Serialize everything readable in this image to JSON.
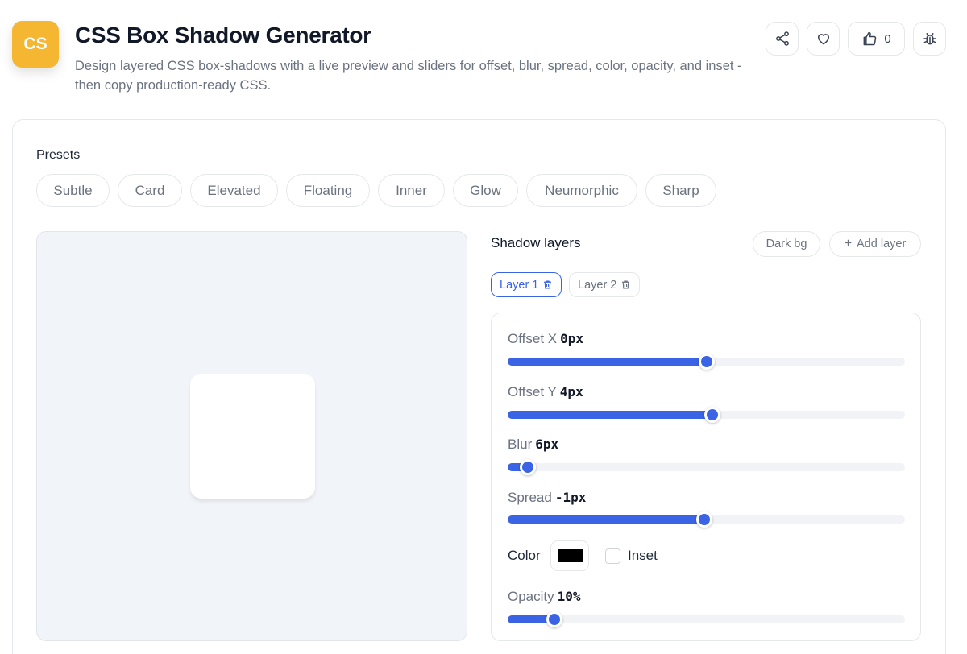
{
  "header": {
    "logo_text": "CS",
    "title": "CSS Box Shadow Generator",
    "description": "Design layered CSS box-shadows with a live preview and sliders for offset, blur, spread, color, opacity, and inset - then copy production-ready CSS.",
    "like_count": "0",
    "icons": [
      "share-icon",
      "heart-icon",
      "thumbs-up-icon",
      "bug-icon"
    ]
  },
  "presets": {
    "label": "Presets",
    "items": [
      "Subtle",
      "Card",
      "Elevated",
      "Floating",
      "Inner",
      "Glow",
      "Neumorphic",
      "Sharp"
    ]
  },
  "layers": {
    "title": "Shadow layers",
    "dark_bg_label": "Dark bg",
    "add_layer_label": "Add layer",
    "tabs": [
      {
        "label": "Layer 1",
        "active": true
      },
      {
        "label": "Layer 2",
        "active": false
      }
    ]
  },
  "controls": {
    "offset_x": {
      "label": "Offset X",
      "value": "0px",
      "fraction": 0.5
    },
    "offset_y": {
      "label": "Offset Y",
      "value": "4px",
      "fraction": 0.516
    },
    "blur": {
      "label": "Blur",
      "value": "6px",
      "fraction": 0.05
    },
    "spread": {
      "label": "Spread",
      "value": "-1px",
      "fraction": 0.495
    },
    "color_label": "Color",
    "color_value": "#000000",
    "inset_label": "Inset",
    "inset_checked": false,
    "opacity": {
      "label": "Opacity",
      "value": "10%",
      "fraction": 0.117
    }
  },
  "colors": {
    "accent": "#3b63e6",
    "logo": "#f5b731",
    "preview_bg": "#f1f4f8"
  }
}
